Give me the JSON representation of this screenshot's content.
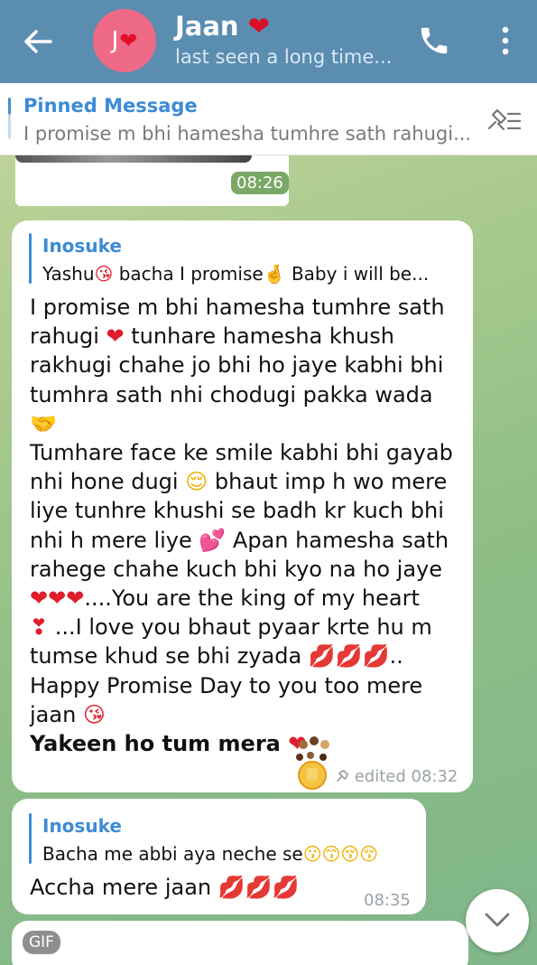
{
  "header": {
    "back_icon": "arrow-left-icon",
    "avatar_letter": "J",
    "avatar_color": "#ef6a86",
    "contact_name": "Jaan",
    "contact_heart": "❤",
    "status": "last seen a long time...",
    "call_icon": "phone-icon",
    "menu_icon": "more-vert-icon",
    "bar_color": "#5b8db1"
  },
  "pinned": {
    "title": "Pinned Message",
    "text": "I promise m bhi hamesha tumhre sath rahugi...",
    "action_icon": "pin-list-icon"
  },
  "media_message": {
    "time": "08:26"
  },
  "messages": [
    {
      "reply_name": "Inosuke",
      "reply_text_1": "Yashu",
      "reply_emoji_1": "😘",
      "reply_text_2": " bacha I promise",
      "reply_emoji_2": "🤞",
      "reply_text_3": " Baby i will be...",
      "lines": [
        "I promise m bhi hamesha tumhre sath",
        "rahugi ",
        " tunhare hamesha khush",
        "rakhugi chahe jo bhi ho jaye kabhi bhi",
        "tumhra sath nhi chodugi pakka wada",
        "🤝",
        "Tumhare face ke smile kabhi bhi gayab",
        "nhi hone dugi ",
        " bhaut imp h wo mere",
        "liye tunhre khushi se badh kr kuch bhi",
        "nhi h mere liye ",
        "  Apan hamesha sath",
        "rahege chahe kuch bhi kyo na ho jaye",
        "....You are the king of my heart",
        " ...I love you bhaut pyaar krte hu m",
        "tumse khud se bhi zyada ",
        "..",
        "Happy Promise Day to you too mere",
        "jaan "
      ],
      "emoji_heart": "❤",
      "emoji_relieved": "😌",
      "emoji_two_hearts": "💕",
      "emoji_hearts_triple": "❤❤❤",
      "emoji_heart_exclaim": "❣",
      "emoji_kiss_marks": "💋💋💋",
      "emoji_kiss_face": "😘",
      "bold_line": "Yakeen ho tum mera ",
      "bold_heart": "❤",
      "meta": "edited 08:32"
    },
    {
      "reply_name": "Inosuke",
      "reply_text": "Bacha me abbi aya neche se",
      "reply_emojis": "😗😙😚😚",
      "text": "Accha mere jaan ",
      "text_emojis": "💋💋💋",
      "time": "08:35"
    }
  ],
  "gif_label": "GIF",
  "scroll_down_icon": "chevron-down-icon"
}
